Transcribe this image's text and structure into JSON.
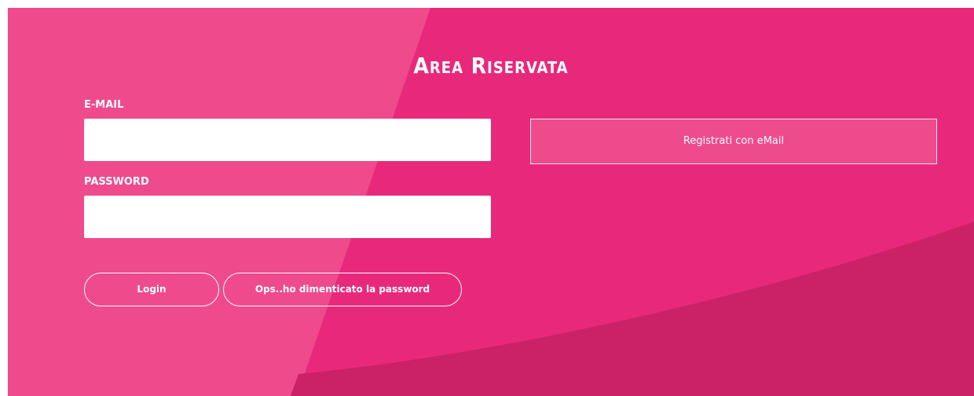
{
  "login": {
    "title": "Area Riservata",
    "email_label": "E-MAIL",
    "email_value": "",
    "password_label": "PASSWORD",
    "password_value": "",
    "login_label": "Login",
    "forgot_label": "Ops..ho dimenticato la password"
  },
  "register": {
    "label": "Registrati con eMail"
  },
  "colors": {
    "pink_main": "#e8297b",
    "pink_light": "#ef4a8c",
    "pink_dark": "#cb2267",
    "text": "#ffffff"
  }
}
